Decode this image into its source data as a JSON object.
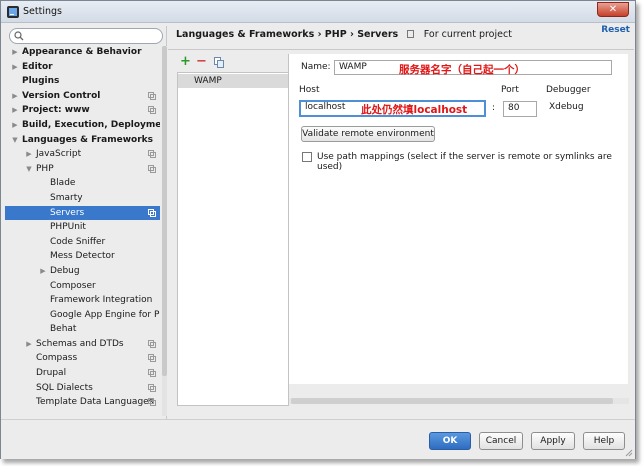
{
  "window": {
    "title": "Settings",
    "close_label": "✕"
  },
  "search": {
    "placeholder": ""
  },
  "tree": {
    "items": [
      {
        "label": "Appearance & Behavior",
        "level": 0,
        "bold": true,
        "arrow": "collapsed",
        "icon": false,
        "selected": false
      },
      {
        "label": "Editor",
        "level": 0,
        "bold": true,
        "arrow": "collapsed",
        "icon": false,
        "selected": false
      },
      {
        "label": "Plugins",
        "level": 0,
        "bold": true,
        "arrow": "none",
        "icon": false,
        "selected": false
      },
      {
        "label": "Version Control",
        "level": 0,
        "bold": true,
        "arrow": "collapsed",
        "icon": true,
        "selected": false
      },
      {
        "label": "Project: www",
        "level": 0,
        "bold": true,
        "arrow": "collapsed",
        "icon": true,
        "selected": false
      },
      {
        "label": "Build, Execution, Deployment",
        "level": 0,
        "bold": true,
        "arrow": "collapsed",
        "icon": false,
        "selected": false
      },
      {
        "label": "Languages & Frameworks",
        "level": 0,
        "bold": true,
        "arrow": "expanded",
        "icon": false,
        "selected": false
      },
      {
        "label": "JavaScript",
        "level": 1,
        "bold": false,
        "arrow": "collapsed",
        "icon": true,
        "selected": false
      },
      {
        "label": "PHP",
        "level": 1,
        "bold": false,
        "arrow": "expanded",
        "icon": true,
        "selected": false
      },
      {
        "label": "Blade",
        "level": 2,
        "bold": false,
        "arrow": "none",
        "icon": false,
        "selected": false
      },
      {
        "label": "Smarty",
        "level": 2,
        "bold": false,
        "arrow": "none",
        "icon": false,
        "selected": false
      },
      {
        "label": "Servers",
        "level": 2,
        "bold": false,
        "arrow": "none",
        "icon": true,
        "selected": true
      },
      {
        "label": "PHPUnit",
        "level": 2,
        "bold": false,
        "arrow": "none",
        "icon": false,
        "selected": false
      },
      {
        "label": "Code Sniffer",
        "level": 2,
        "bold": false,
        "arrow": "none",
        "icon": false,
        "selected": false
      },
      {
        "label": "Mess Detector",
        "level": 2,
        "bold": false,
        "arrow": "none",
        "icon": false,
        "selected": false
      },
      {
        "label": "Debug",
        "level": 2,
        "bold": false,
        "arrow": "collapsed",
        "icon": false,
        "selected": false
      },
      {
        "label": "Composer",
        "level": 2,
        "bold": false,
        "arrow": "none",
        "icon": false,
        "selected": false
      },
      {
        "label": "Framework Integration",
        "level": 2,
        "bold": false,
        "arrow": "none",
        "icon": false,
        "selected": false
      },
      {
        "label": "Google App Engine for PH",
        "level": 2,
        "bold": false,
        "arrow": "none",
        "icon": false,
        "selected": false
      },
      {
        "label": "Behat",
        "level": 2,
        "bold": false,
        "arrow": "none",
        "icon": false,
        "selected": false
      },
      {
        "label": "Schemas and DTDs",
        "level": 1,
        "bold": false,
        "arrow": "collapsed",
        "icon": true,
        "selected": false
      },
      {
        "label": "Compass",
        "level": 1,
        "bold": false,
        "arrow": "none",
        "icon": true,
        "selected": false
      },
      {
        "label": "Drupal",
        "level": 1,
        "bold": false,
        "arrow": "none",
        "icon": true,
        "selected": false
      },
      {
        "label": "SQL Dialects",
        "level": 1,
        "bold": false,
        "arrow": "none",
        "icon": true,
        "selected": false
      },
      {
        "label": "Template Data Languages",
        "level": 1,
        "bold": false,
        "arrow": "none",
        "icon": true,
        "selected": false
      }
    ]
  },
  "breadcrumb": {
    "path": "Languages & Frameworks › PHP › Servers",
    "for_project": "For current project"
  },
  "reset_label": "Reset",
  "toolbar": {
    "add": "+",
    "remove": "−"
  },
  "servers": [
    {
      "name": "WAMP"
    }
  ],
  "form": {
    "name_label": "Name:",
    "name_value": "WAMP",
    "name_annotation": "服务器名字（自己起一个）",
    "host_label": "Host",
    "host_value": "localhost",
    "host_annotation": "此处仍然填localhost",
    "port_label": "Port",
    "port_value": "80",
    "port_separator": ":",
    "debugger_label": "Debugger",
    "debugger_value": "Xdebug",
    "validate_label": "Validate remote environment",
    "path_mappings_label": "Use path mappings (select if the server is remote or symlinks are used)"
  },
  "buttons": {
    "ok": "OK",
    "cancel": "Cancel",
    "apply": "Apply",
    "help": "Help"
  },
  "colors": {
    "selection": "#3a78cc",
    "annotation": "#e01515",
    "primary_button": "#2f6cc0",
    "add": "#2a9a2a",
    "remove": "#d23b3b"
  }
}
